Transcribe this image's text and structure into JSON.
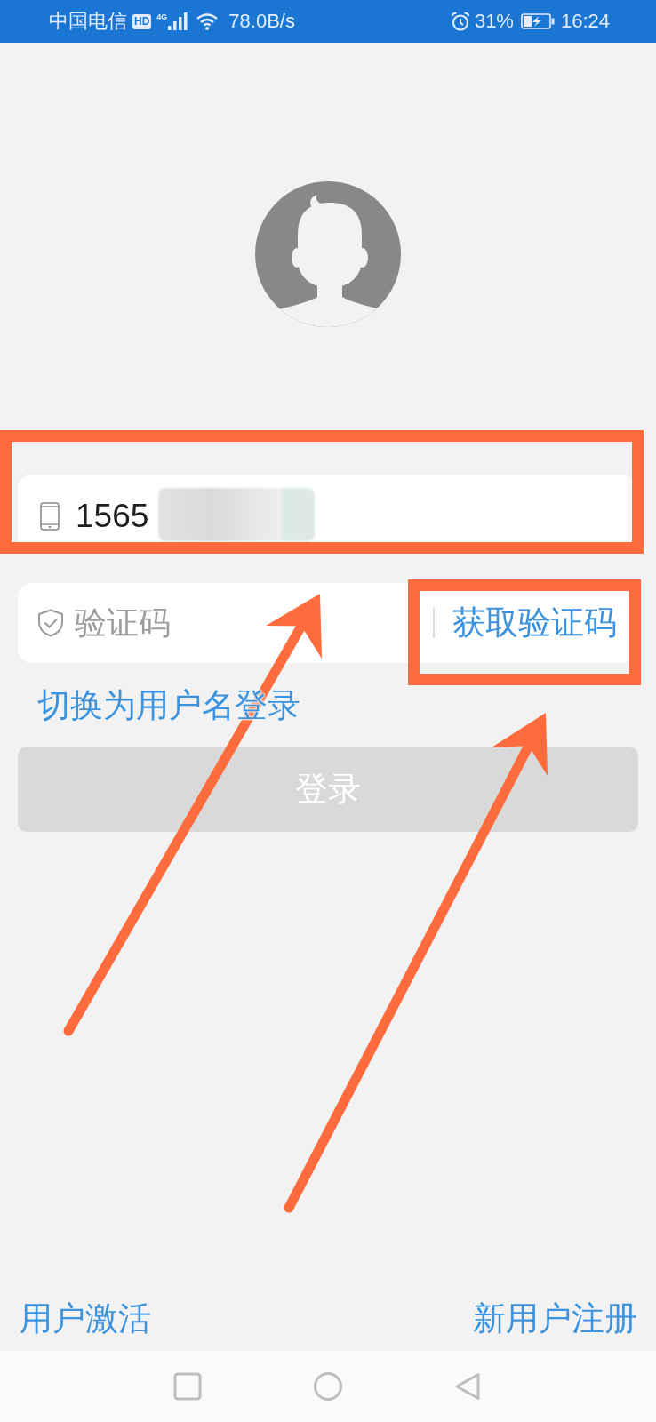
{
  "status_bar": {
    "carrier": "中国电信",
    "hd_badge": "HD",
    "network_type": "4G",
    "speed": "78.0B/s",
    "battery": "31%",
    "time": "16:24"
  },
  "login_form": {
    "phone_field": {
      "value": "1565",
      "redacted": true
    },
    "code_field": {
      "placeholder": "验证码"
    },
    "get_code_button": {
      "label": "获取验证码"
    },
    "switch_link": {
      "label": "切换为用户名登录"
    },
    "login_button": {
      "label": "登录",
      "disabled": true
    }
  },
  "footer": {
    "activate_link": "用户激活",
    "register_link": "新用户注册"
  }
}
